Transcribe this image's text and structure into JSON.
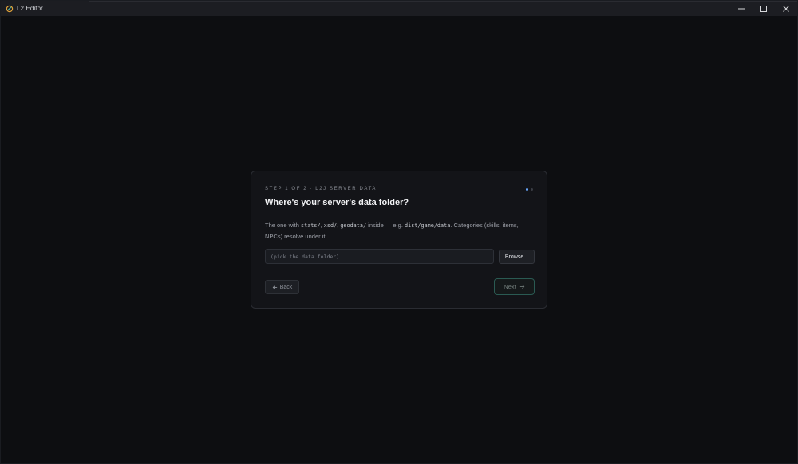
{
  "window": {
    "title": "L2 Editor",
    "controls": {
      "minimize": "—",
      "maximize": "☐",
      "close": "✕"
    }
  },
  "wizard": {
    "step_label": "STEP 1 OF 2 · L2J SERVER DATA",
    "step_current": 1,
    "step_total": 2,
    "heading": "Where's your server's data folder?",
    "description": {
      "part1": "The one with ",
      "code1": "stats/",
      "sep1": ", ",
      "code2": "xsd/",
      "sep2": ", ",
      "code3": "geodata/",
      "part2": " inside — e.g. ",
      "code4": "dist/game/data",
      "part3": ". Categories (skills, items, NPCs) resolve under it."
    },
    "path_input": {
      "value": "",
      "placeholder": "(pick the data folder)"
    },
    "browse_label": "Browse...",
    "back_label": "Back",
    "back_icon": "arrow-left-icon",
    "next_label": "Next",
    "next_icon": "arrow-right-icon"
  },
  "colors": {
    "background": "#0d0e11",
    "titlebar": "#1c1d22",
    "card": "#131418",
    "accent_dot": "#6aa8ff",
    "next_border": "#2a5a52"
  }
}
